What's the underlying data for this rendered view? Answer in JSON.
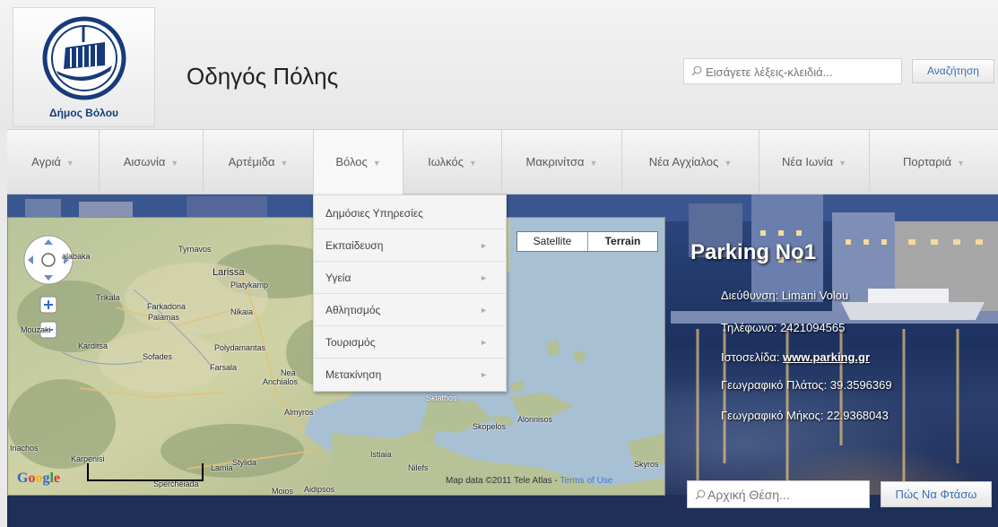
{
  "header": {
    "logo_text": "Δήμος Βόλου",
    "site_title": "Οδηγός Πόλης",
    "search_placeholder": "Εισάγετε λέξεις-κλειδιά...",
    "search_button": "Αναζήτηση"
  },
  "nav": {
    "items": [
      {
        "label": "Αγριά"
      },
      {
        "label": "Αισωνία"
      },
      {
        "label": "Αρτέμιδα"
      },
      {
        "label": "Βόλος"
      },
      {
        "label": "Ιωλκός"
      },
      {
        "label": "Μακρινίτσα"
      },
      {
        "label": "Νέα Αγχίαλος"
      },
      {
        "label": "Νέα Ιωνία"
      },
      {
        "label": "Πορταριά"
      }
    ],
    "active": "Βόλος"
  },
  "dropdown": {
    "items": [
      {
        "label": "Δημόσιες Υπηρεσίες",
        "has_sub": false
      },
      {
        "label": "Εκπαίδευση",
        "has_sub": true
      },
      {
        "label": "Υγεία",
        "has_sub": true
      },
      {
        "label": "Αθλητισμός",
        "has_sub": true
      },
      {
        "label": "Τουρισμός",
        "has_sub": true
      },
      {
        "label": "Μετακίνηση",
        "has_sub": true
      }
    ]
  },
  "map": {
    "type_buttons": {
      "satellite": "Satellite",
      "terrain": "Terrain"
    },
    "selected_type": "Terrain",
    "places": {
      "larissa": "Larissa",
      "tyrnavos": "Tyrnavos",
      "platykampos": "Platykamp",
      "trikala": "Trikala",
      "farkadona": "Farkadona",
      "palamas": "Palamas",
      "nikaia": "Nikaia",
      "kalabaka": "alabaka",
      "mouzaki": "Mouzaki",
      "karditsa": "Karditsa",
      "sofades": "Sofades",
      "farsala": "Farsala",
      "polydamantas": "Polydamantas",
      "nea": "Nea",
      "anchialos": "Anchialos",
      "almyros": "Almyros",
      "skiathos": "Skiathos",
      "skopelos": "Skopelos",
      "alonnisos": "Alonnisos",
      "istiaia": "Istiaia",
      "nilefs": "Nilefs",
      "skyros": "Skyros",
      "lamia": "Lamia",
      "stylida": "Stylida",
      "spercheiada": "Spercheiada",
      "inachos": "Inachos",
      "karpenisi": "Karpenisi",
      "moios": "Moios",
      "aidipsos": "Aidipsos"
    },
    "copyright": "Map data ©2011 Tele Atlas - ",
    "terms": "Terms of Use",
    "google": "Google"
  },
  "info": {
    "title": "Parking No1",
    "address_label": "Διεύθυνση:",
    "address": "Limani Volou",
    "phone_label": "Τηλέφωνο:",
    "phone": "2421094565",
    "website_label": "Ιστοσελίδα:",
    "website": "www.parking.gr",
    "lat_label": "Γεωγραφικό Πλάτος:",
    "lat": "39.3596369",
    "lng_label": "Γεωγραφικό Μήκος:",
    "lng": "22.9368043"
  },
  "route": {
    "start_placeholder": "Αρχική Θέση...",
    "button": "Πώς Να Φτάσω"
  },
  "colors": {
    "link_blue": "#3a70b5",
    "logo_blue": "#173a7c"
  }
}
